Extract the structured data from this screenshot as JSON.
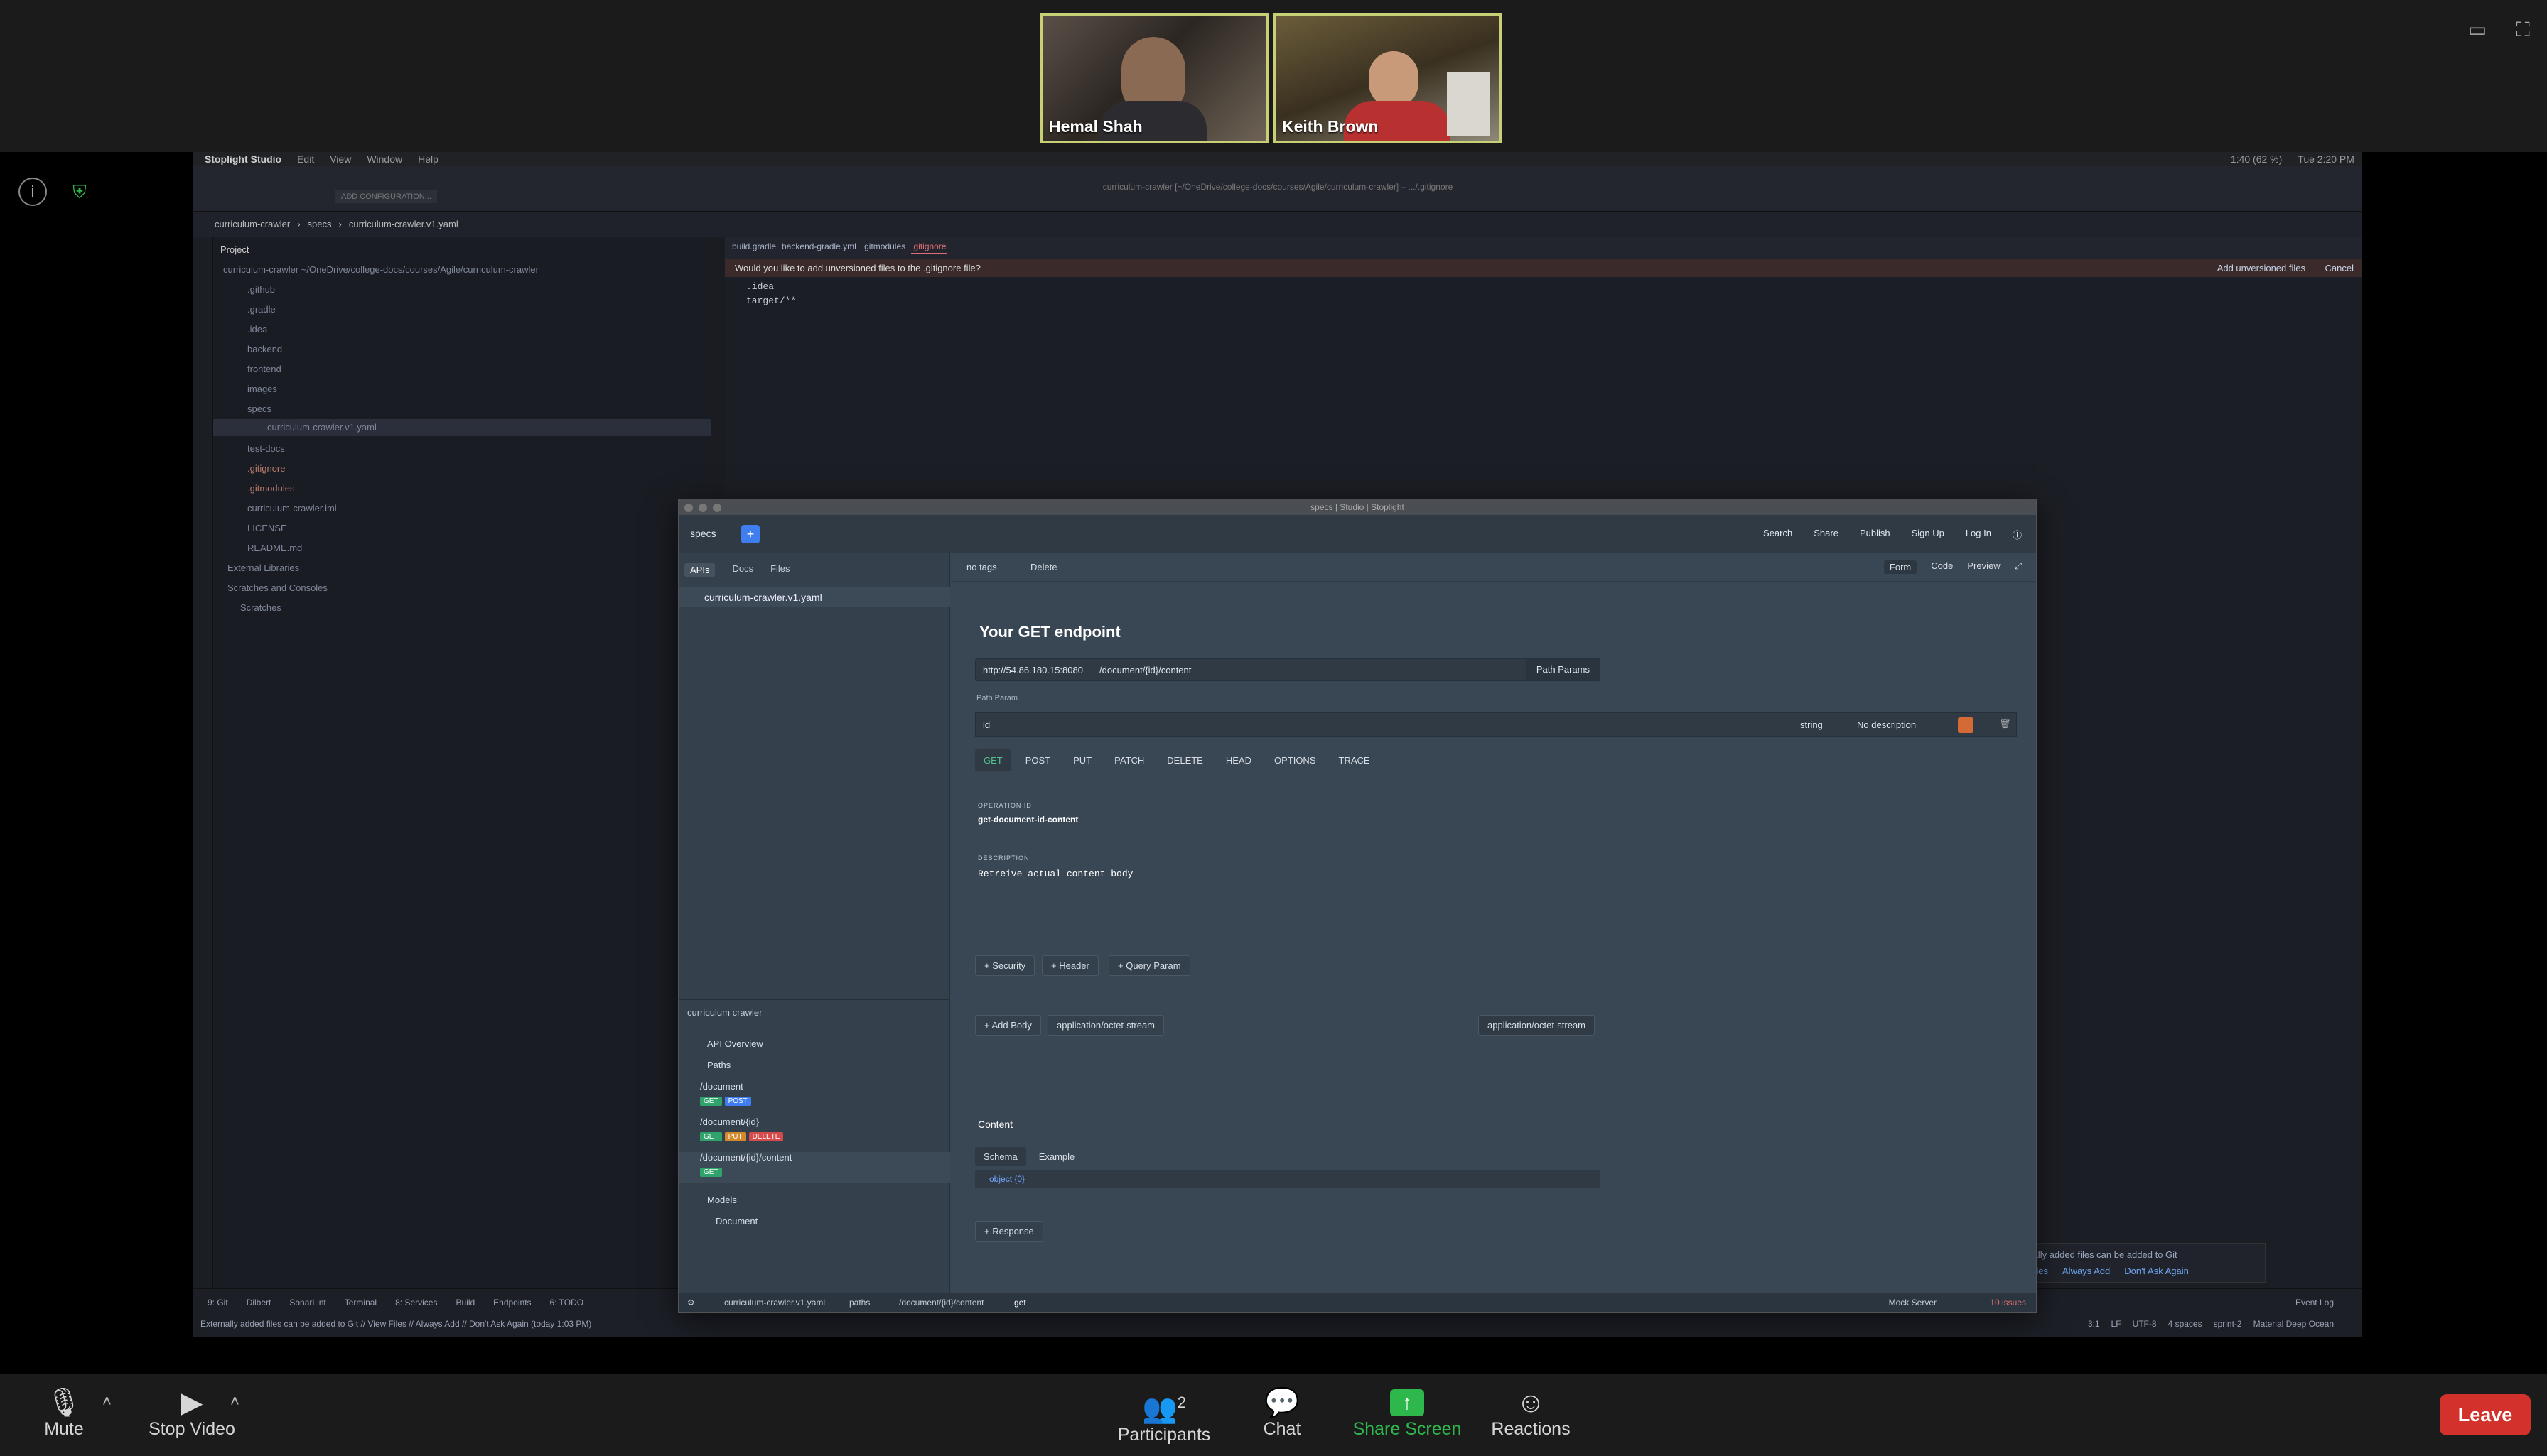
{
  "zoom": {
    "participants": [
      {
        "name": "Hemal Shah"
      },
      {
        "name": "Keith Brown"
      }
    ],
    "controls": {
      "mute": "Mute",
      "stop_video": "Stop Video",
      "participants": "Participants",
      "participants_count": "2",
      "chat": "Chat",
      "share_screen": "Share Screen",
      "reactions": "Reactions",
      "leave": "Leave"
    },
    "colors": {
      "leave": "#d3322c",
      "share": "#2eb84b",
      "active_speaker": "#c9cf74"
    }
  },
  "ide": {
    "menu": [
      "Stoplight Studio",
      "Edit",
      "View",
      "Window",
      "Help"
    ],
    "clock": "1:40 (62 %)",
    "time": "Tue 2:20 PM",
    "window_title": "curriculum-crawler [~/OneDrive/college-docs/courses/Agile/curriculum-crawler] – .../.gitignore",
    "toolbar_config": "ADD CONFIGURATION...",
    "breadcrumb": [
      "curriculum-crawler",
      "specs",
      "curriculum-crawler.v1.yaml"
    ],
    "project_label": "Project",
    "project_root": "curriculum-crawler ~/OneDrive/college-docs/courses/Agile/curriculum-crawler",
    "tree": [
      ".github",
      ".gradle",
      ".idea",
      "backend",
      "frontend",
      "images",
      "specs",
      "curriculum-crawler.v1.yaml",
      "test-docs",
      ".gitignore",
      ".gitmodules",
      "curriculum-crawler.iml",
      "LICENSE",
      "README.md",
      "External Libraries",
      "Scratches and Consoles",
      "Scratches"
    ],
    "editor_tabs": [
      "build.gradle",
      "backend-gradle.yml",
      ".gitmodules",
      ".gitignore"
    ],
    "git_prompt": "Would you like to add unversioned files to the .gitignore file?",
    "git_add": "Add unversioned files",
    "git_cancel": "Cancel",
    "code_lines": [
      ".idea",
      "target/**"
    ],
    "bottom_tools": [
      "9: Git",
      "Dilbert",
      "SonarLint",
      "Terminal",
      "8: Services",
      "Build",
      "Endpoints",
      "6: TODO"
    ],
    "event_log": "Event Log",
    "statusline": "Externally added files can be added to Git // View Files // Always Add // Don't Ask Again (today 1:03 PM)",
    "status_right": [
      "3:1",
      "LF",
      "UTF-8",
      "4 spaces",
      "sprint-2",
      "Material Deep Ocean"
    ],
    "notif_text": "Externally added files can be added to Git",
    "notif_links": [
      "View Files",
      "Always Add",
      "Don't Ask Again"
    ]
  },
  "stoplight": {
    "window_title": "specs | Studio | Stoplight",
    "workspace": "specs",
    "top_actions": [
      "Search",
      "Share",
      "Publish",
      "Sign Up",
      "Log In"
    ],
    "side_tabs": [
      "APIs",
      "Docs",
      "Files"
    ],
    "file": "curriculum-crawler.v1.yaml",
    "outline_title": "curriculum crawler",
    "outline": {
      "overview": "API Overview",
      "paths_label": "Paths",
      "paths": [
        {
          "path": "/document",
          "methods": [
            "GET",
            "POST"
          ]
        },
        {
          "path": "/document/{id}",
          "methods": [
            "GET",
            "PUT",
            "DELETE"
          ]
        },
        {
          "path": "/document/{id}/content",
          "methods": [
            "GET"
          ]
        }
      ],
      "models_label": "Models",
      "models": [
        "Document"
      ]
    },
    "toolbar": {
      "tags": "no tags",
      "delete": "Delete",
      "modes": [
        "Form",
        "Code",
        "Preview"
      ]
    },
    "endpoint": {
      "title": "Your GET endpoint",
      "host": "http://54.86.180.15:8080",
      "path": "/document/{id}/content",
      "path_params_btn": "Path Params",
      "path_param_label": "Path Param",
      "param_name": "id",
      "param_type": "string",
      "param_desc": "No description",
      "methods": [
        "GET",
        "POST",
        "PUT",
        "PATCH",
        "DELETE",
        "HEAD",
        "OPTIONS",
        "TRACE"
      ],
      "active_method": "GET",
      "operation_id_label": "OPERATION ID",
      "operation_id": "get-document-id-content",
      "description_label": "DESCRIPTION",
      "description": "Retreive actual content body",
      "add_buttons": [
        "Security",
        "Header",
        "Query Param"
      ],
      "add_body": "Add Body",
      "body_type": "application/octet-stream",
      "body_type_right": "application/octet-stream",
      "content_label": "Content",
      "schema_tabs": [
        "Schema",
        "Example"
      ],
      "schema_row": "object {0}",
      "response_btn": "Response"
    },
    "status_crumbs": [
      "curriculum-crawler.v1.yaml",
      "paths",
      "/document/{id}/content",
      "get"
    ],
    "status_right": [
      "Mock Server",
      "10 issues"
    ]
  }
}
